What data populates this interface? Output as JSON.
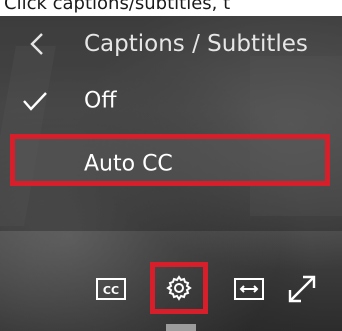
{
  "top_caption": "Click captions/subtitles, t",
  "menu": {
    "back_icon": "chevron-left-icon",
    "title": "Captions / Subtitles",
    "options": [
      {
        "label": "Off",
        "selected": true
      },
      {
        "label": "Auto CC",
        "selected": false,
        "highlighted": true
      }
    ]
  },
  "controls": {
    "cc_label": "CC",
    "icons": [
      "closed-captions-icon",
      "settings-gear-icon",
      "fit-width-icon",
      "fullscreen-expand-icon"
    ]
  },
  "colors": {
    "highlight": "#d61f2a",
    "text": "#ffffff"
  }
}
